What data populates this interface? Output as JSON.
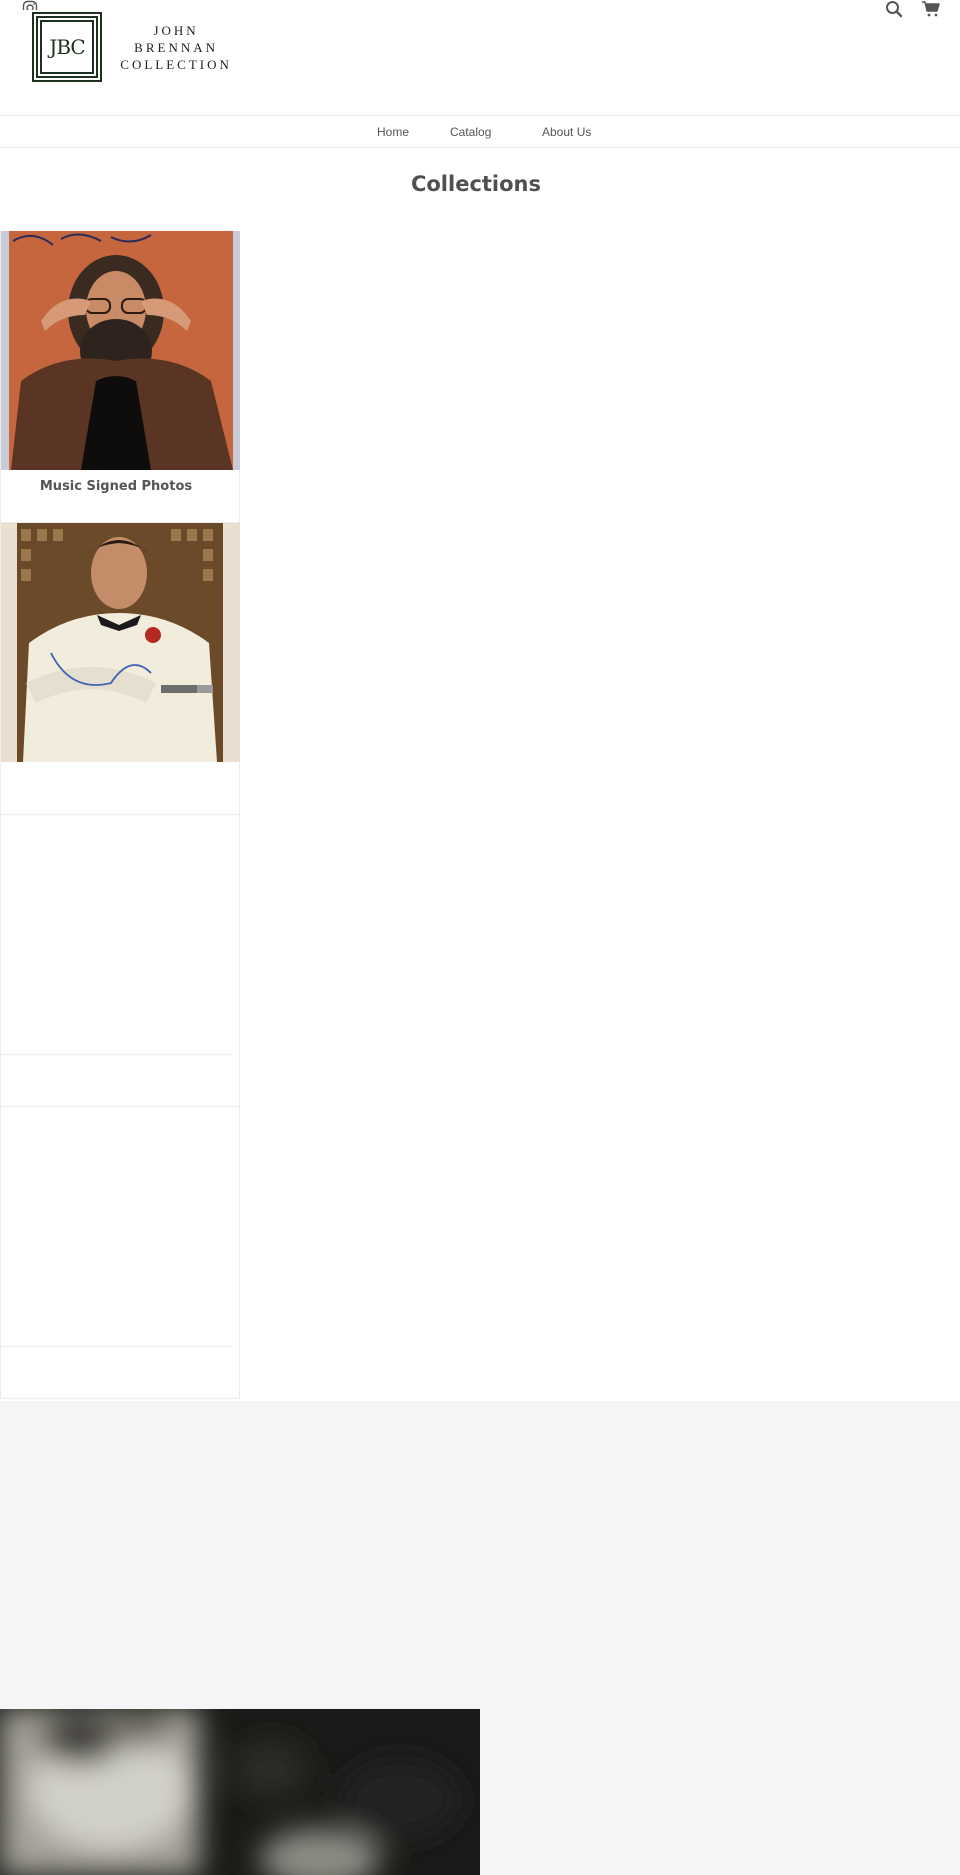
{
  "header": {
    "brand_line1": "JOHN BRENNAN",
    "brand_line2": "COLLECTION",
    "logo_monogram": "JBC",
    "icons": [
      "instagram-icon",
      "search-icon",
      "cart-icon"
    ]
  },
  "nav": {
    "items": [
      {
        "label": "Home"
      },
      {
        "label": "Catalog"
      },
      {
        "label": "About Us"
      }
    ]
  },
  "page": {
    "title": "Collections"
  },
  "collections": [
    {
      "label": "Music Signed Photos",
      "image": "signed-photo-musician"
    },
    {
      "label": "",
      "image": "signed-photo-actor-tuxedo"
    },
    {
      "label": "",
      "image": ""
    },
    {
      "label": "",
      "image": ""
    }
  ],
  "colors": {
    "brand": "#1e3020",
    "text": "#555555",
    "footer_bg": "#f5f5f5"
  }
}
